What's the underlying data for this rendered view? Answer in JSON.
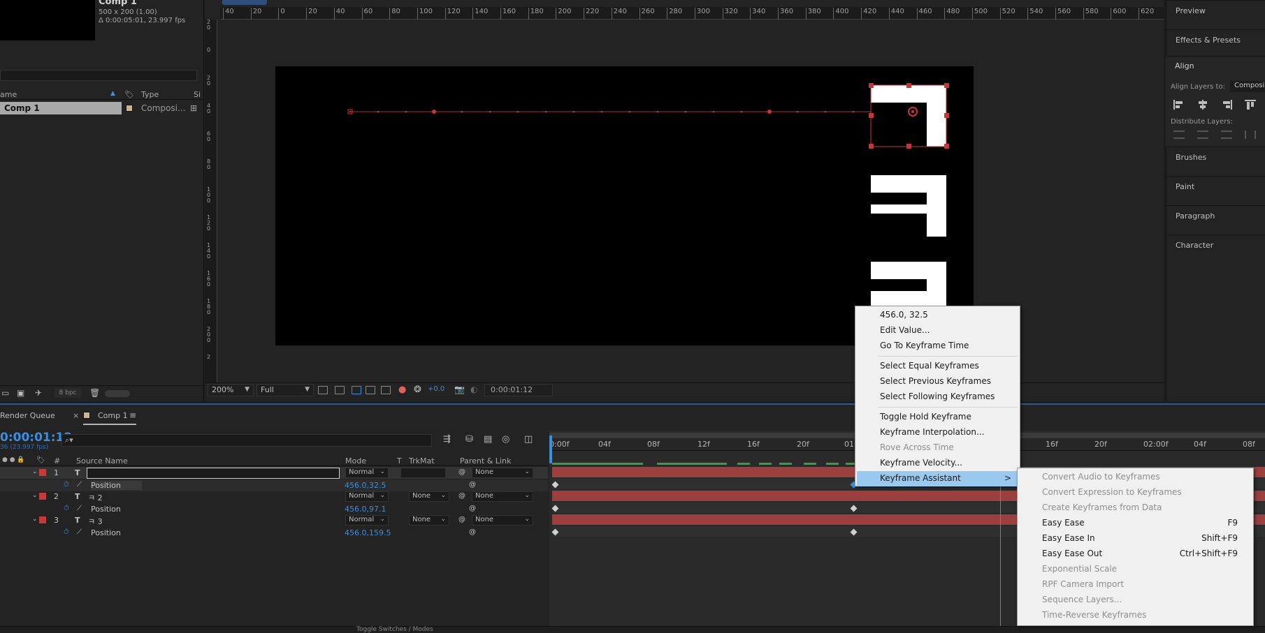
{
  "project": {
    "comp_title": "Comp 1",
    "comp_dims": "500 x 200 (1.00)",
    "comp_duration": "Δ 0:00:05:01, 23.997 fps",
    "columns": [
      "ame",
      "Type",
      "Si"
    ],
    "item_name": "Comp 1",
    "item_type": "Composi...",
    "bpc": "8 bpc"
  },
  "viewer": {
    "ruler_ticks": [
      "40",
      "20",
      "0",
      "20",
      "40",
      "60",
      "80",
      "100",
      "120",
      "140",
      "160",
      "180",
      "200",
      "220",
      "240",
      "260",
      "280",
      "300",
      "320",
      "340",
      "360",
      "380",
      "400",
      "420",
      "440",
      "460",
      "480",
      "500",
      "520",
      "540",
      "560",
      "580",
      "600",
      "620"
    ],
    "vruler_ticks": [
      "2\n0",
      "0",
      "2\n0",
      "4\n0",
      "6\n0",
      "8\n0",
      "1\n0\n0",
      "1\n2\n0",
      "1\n4\n0",
      "1\n6\n0",
      "1\n8\n0",
      "2\n0\n0",
      "2"
    ],
    "zoom": "200%",
    "resolution": "Full",
    "exposure": "+0.0",
    "current_time": "0:00:01:12"
  },
  "right_panels": {
    "preview": "Preview",
    "effects": "Effects & Presets",
    "align": "Align",
    "align_to_label": "Align Layers to:",
    "align_to_value": "Composi",
    "distribute": "Distribute Layers:",
    "brushes": "Brushes",
    "paint": "Paint",
    "paragraph": "Paragraph",
    "character": "Character"
  },
  "timeline": {
    "tab_render_queue": "Render Queue",
    "tab_comp": "Comp 1",
    "timecode": "0:00:01:12",
    "fps": "36 (23.997 fps)",
    "columns": {
      "hash": "#",
      "source": "Source Name",
      "mode": "Mode",
      "t": "T",
      "trkmat": "TrkMat",
      "parent": "Parent & Link"
    },
    "layers": [
      {
        "num": "1",
        "name": "ㅋ",
        "mode": "Normal",
        "trkmat": "",
        "parent": "None",
        "prop": "Position",
        "value": "456.0,32.5"
      },
      {
        "num": "2",
        "name": "ㅋ 2",
        "mode": "Normal",
        "trkmat": "None",
        "parent": "None",
        "prop": "Position",
        "value": "456.0,97.1"
      },
      {
        "num": "3",
        "name": "ㅋ 3",
        "mode": "Normal",
        "trkmat": "None",
        "parent": "None",
        "prop": "Position",
        "value": "456.0,159.5"
      }
    ],
    "time_ticks": [
      "0:00f",
      "04f",
      "08f",
      "12f",
      "16f",
      "20f",
      "01:0",
      "16f",
      "20f",
      "02:00f",
      "04f",
      "08f"
    ],
    "footer": "Toggle Switches / Modes"
  },
  "context_menu": {
    "items": [
      {
        "label": "456.0, 32.5",
        "disabled": false
      },
      {
        "label": "Edit Value...",
        "disabled": false
      },
      {
        "label": "Go To Keyframe Time",
        "disabled": false
      },
      {
        "label": "Select Equal Keyframes",
        "disabled": false
      },
      {
        "label": "Select Previous Keyframes",
        "disabled": false
      },
      {
        "label": "Select Following Keyframes",
        "disabled": false
      },
      {
        "label": "Toggle Hold Keyframe",
        "disabled": false
      },
      {
        "label": "Keyframe Interpolation...",
        "disabled": false
      },
      {
        "label": "Rove Across Time",
        "disabled": true
      },
      {
        "label": "Keyframe Velocity...",
        "disabled": false
      },
      {
        "label": "Keyframe Assistant",
        "disabled": false
      }
    ],
    "submenu_arrow": ">"
  },
  "submenu": {
    "items": [
      {
        "label": "Convert Audio to Keyframes",
        "shortcut": "",
        "disabled": true
      },
      {
        "label": "Convert Expression to Keyframes",
        "shortcut": "",
        "disabled": true
      },
      {
        "label": "Create Keyframes from Data",
        "shortcut": "",
        "disabled": true
      },
      {
        "label": "Easy Ease",
        "shortcut": "F9",
        "disabled": false
      },
      {
        "label": "Easy Ease In",
        "shortcut": "Shift+F9",
        "disabled": false
      },
      {
        "label": "Easy Ease Out",
        "shortcut": "Ctrl+Shift+F9",
        "disabled": false
      },
      {
        "label": "Exponential Scale",
        "shortcut": "",
        "disabled": true
      },
      {
        "label": "RPF Camera Import",
        "shortcut": "",
        "disabled": true
      },
      {
        "label": "Sequence Layers...",
        "shortcut": "",
        "disabled": true
      },
      {
        "label": "Time-Reverse Keyframes",
        "shortcut": "",
        "disabled": true
      }
    ]
  },
  "colors": {
    "accent": "#3b8fe0",
    "label_red": "#c83a3a",
    "menu_highlight": "#99c9ef",
    "layer_bar": "#9c3f3f"
  }
}
